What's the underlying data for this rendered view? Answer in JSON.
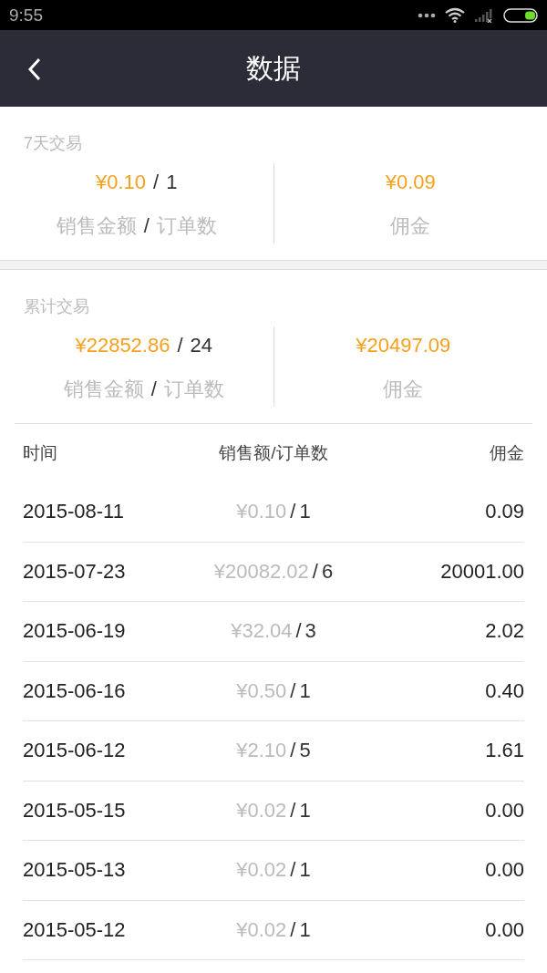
{
  "status_bar": {
    "time": "9:55"
  },
  "header": {
    "title": "数据"
  },
  "summaries": [
    {
      "title": "7天交易",
      "sales": {
        "amount": "¥0.10",
        "separator": "/",
        "count": "1",
        "amount_label": "销售金额",
        "label_separator": "/",
        "count_label": "订单数"
      },
      "commission": {
        "amount": "¥0.09",
        "label": "佣金"
      }
    },
    {
      "title": "累计交易",
      "sales": {
        "amount": "¥22852.86",
        "separator": "/",
        "count": "24",
        "amount_label": "销售金额",
        "label_separator": "/",
        "count_label": "订单数"
      },
      "commission": {
        "amount": "¥20497.09",
        "label": "佣金"
      }
    }
  ],
  "table": {
    "columns": [
      "时间",
      "销售额/订单数",
      "佣金"
    ],
    "rows": [
      {
        "date": "2015-08-11",
        "amount": "¥0.10",
        "separator": "/",
        "count": "1",
        "commission": "0.09"
      },
      {
        "date": "2015-07-23",
        "amount": "¥20082.02",
        "separator": "/",
        "count": "6",
        "commission": "20001.00"
      },
      {
        "date": "2015-06-19",
        "amount": "¥32.04",
        "separator": "/",
        "count": "3",
        "commission": "2.02"
      },
      {
        "date": "2015-06-16",
        "amount": "¥0.50",
        "separator": "/",
        "count": "1",
        "commission": "0.40"
      },
      {
        "date": "2015-06-12",
        "amount": "¥2.10",
        "separator": "/",
        "count": "5",
        "commission": "1.61"
      },
      {
        "date": "2015-05-15",
        "amount": "¥0.02",
        "separator": "/",
        "count": "1",
        "commission": "0.00"
      },
      {
        "date": "2015-05-13",
        "amount": "¥0.02",
        "separator": "/",
        "count": "1",
        "commission": "0.00"
      },
      {
        "date": "2015-05-12",
        "amount": "¥0.02",
        "separator": "/",
        "count": "1",
        "commission": "0.00"
      }
    ]
  }
}
